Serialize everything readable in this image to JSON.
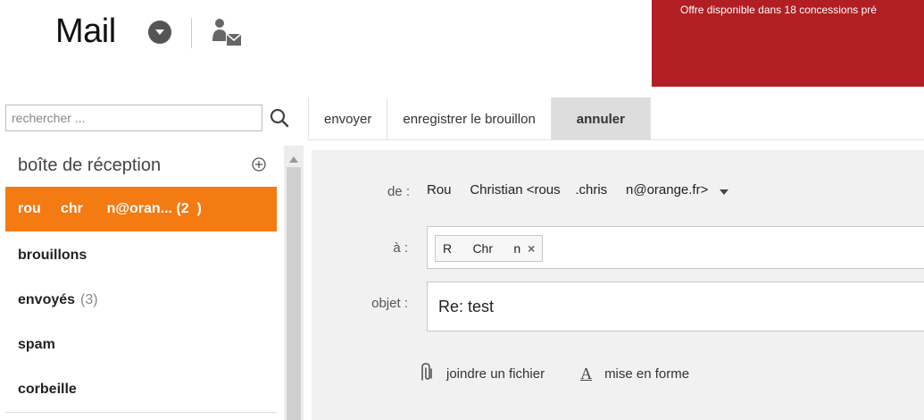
{
  "header": {
    "app_title": "Mail",
    "ad_text": "Offre disponible dans 18 concessions pré"
  },
  "search": {
    "placeholder": "rechercher ..."
  },
  "toolbar": {
    "send_label": "envoyer",
    "save_draft_label": "enregistrer le brouillon",
    "cancel_label": "annuler"
  },
  "sidebar": {
    "header_label": "boîte de réception",
    "items": [
      {
        "label": "rou     chr      n@oran... (2  )",
        "count": ""
      },
      {
        "label": "brouillons",
        "count": ""
      },
      {
        "label": "envoyés",
        "count": "(3)"
      },
      {
        "label": "spam",
        "count": ""
      },
      {
        "label": "corbeille",
        "count": ""
      }
    ]
  },
  "compose": {
    "from_label": "de :",
    "from_value": "Rou     Christian <rous    .chris     n@orange.fr>",
    "to_label": "à :",
    "to_chip": "R      Chr      n",
    "to_chip_remove": "×",
    "subject_label": "objet :",
    "subject_value": "Re: test",
    "attach_label": "joindre un fichier",
    "format_glyph": "A",
    "format_label": "mise en forme"
  },
  "colors": {
    "accent": "#f47a12",
    "ad_background": "#b11f24"
  }
}
